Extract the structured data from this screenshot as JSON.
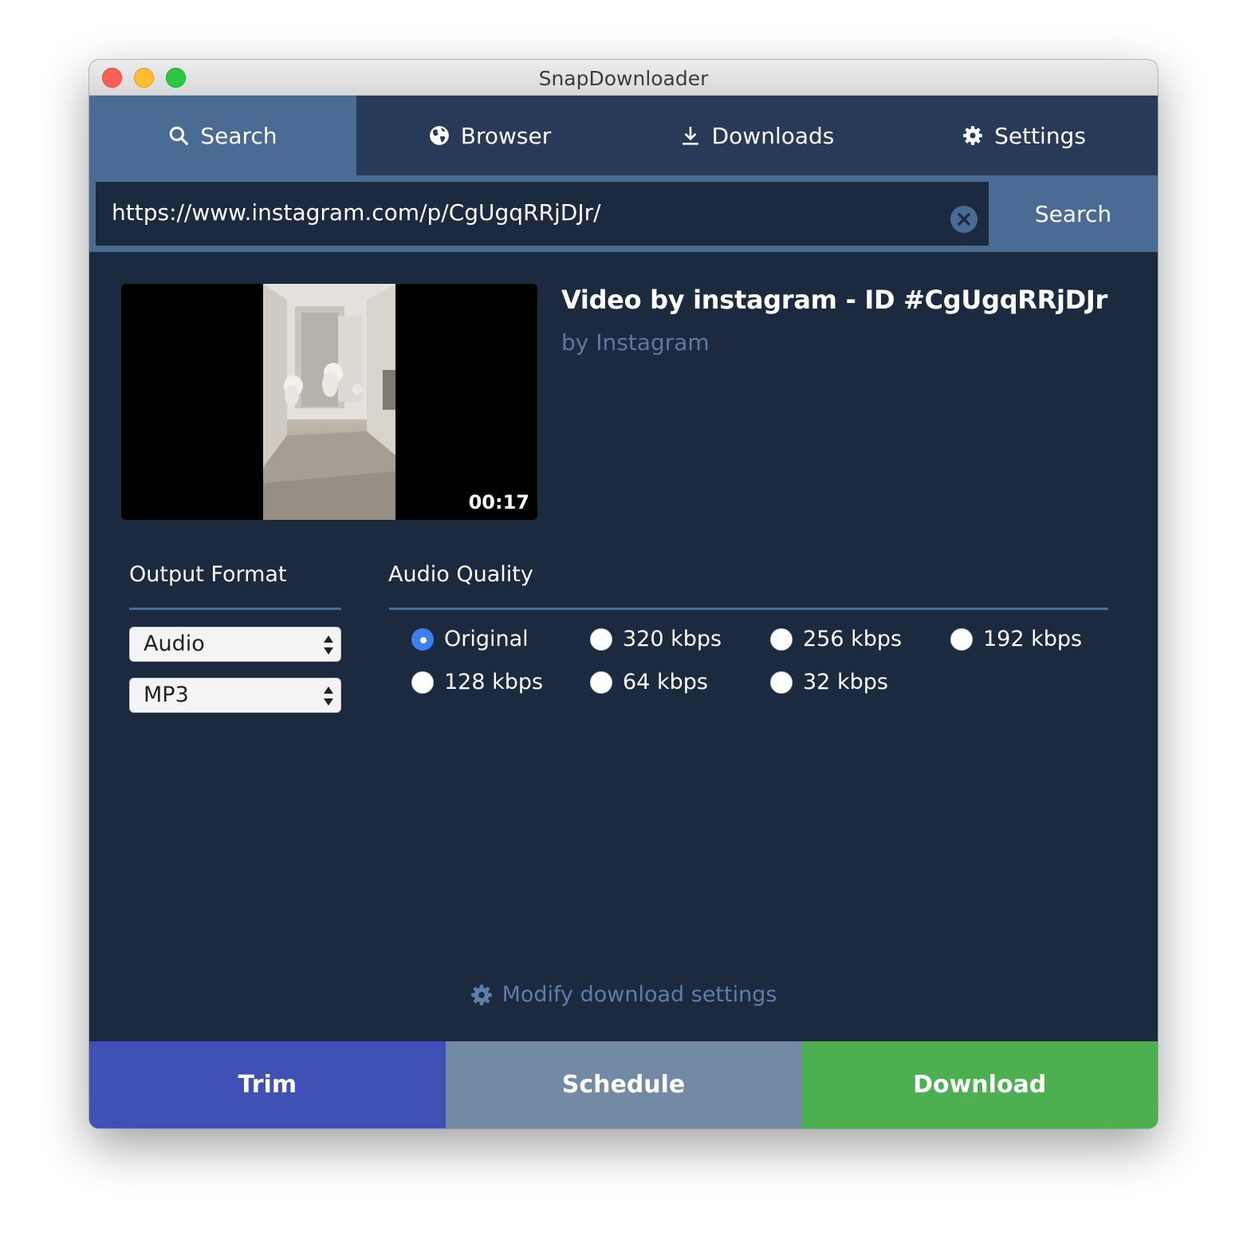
{
  "window": {
    "title": "SnapDownloader"
  },
  "tabs": [
    {
      "label": "Search",
      "icon": "search-icon",
      "active": true
    },
    {
      "label": "Browser",
      "icon": "globe-icon",
      "active": false
    },
    {
      "label": "Downloads",
      "icon": "download-icon",
      "active": false
    },
    {
      "label": "Settings",
      "icon": "gear-icon",
      "active": false
    }
  ],
  "search": {
    "url": "https://www.instagram.com/p/CgUgqRRjDJr/",
    "button_label": "Search"
  },
  "video": {
    "duration": "00:17",
    "title": "Video by instagram - ID #CgUgqRRjDJr",
    "author": "by Instagram"
  },
  "output_format": {
    "label": "Output Format",
    "type_value": "Audio",
    "format_value": "MP3"
  },
  "audio_quality": {
    "label": "Audio Quality",
    "options": [
      {
        "label": "Original",
        "checked": true
      },
      {
        "label": "320 kbps",
        "checked": false
      },
      {
        "label": "256 kbps",
        "checked": false
      },
      {
        "label": "192 kbps",
        "checked": false
      },
      {
        "label": "128 kbps",
        "checked": false
      },
      {
        "label": "64 kbps",
        "checked": false
      },
      {
        "label": "32 kbps",
        "checked": false
      }
    ]
  },
  "modify_settings": {
    "label": "Modify download settings"
  },
  "actions": {
    "trim": "Trim",
    "schedule": "Schedule",
    "download": "Download"
  },
  "colors": {
    "background": "#1c2a3f",
    "tab_bar": "#273a57",
    "accent": "#4a6c94",
    "trim": "#3f51b5",
    "schedule": "#738aa5",
    "download": "#4caf50",
    "radio_checked": "#3b7ff0"
  }
}
